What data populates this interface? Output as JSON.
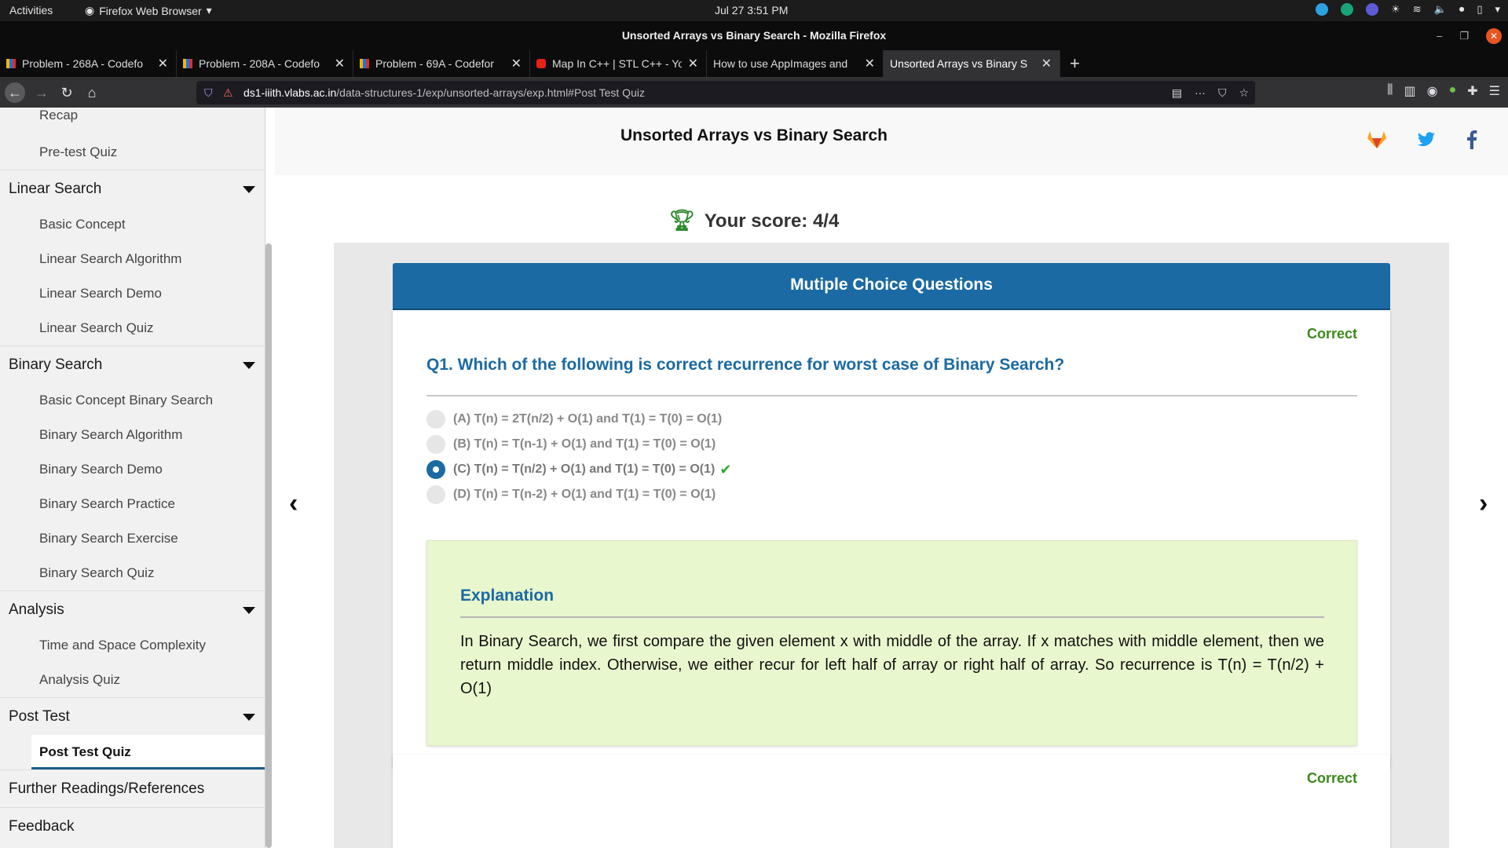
{
  "system": {
    "activities": "Activities",
    "app_name": "Firefox Web Browser",
    "clock": "Jul 27  3:51 PM"
  },
  "window": {
    "title": "Unsorted Arrays vs Binary Search - Mozilla Firefox"
  },
  "tabs": [
    {
      "label": "Problem - 268A - Codefo",
      "favicon": "codeforces"
    },
    {
      "label": "Problem - 208A - Codefo",
      "favicon": "codeforces"
    },
    {
      "label": "Problem - 69A - Codefor",
      "favicon": "codeforces"
    },
    {
      "label": "Map In C++ | STL C++ - Yo",
      "favicon": "youtube"
    },
    {
      "label": "How to use AppImages and",
      "favicon": "none"
    },
    {
      "label": "Unsorted Arrays vs Binary S",
      "favicon": "none",
      "active": true
    }
  ],
  "url": {
    "host": "ds1-iiith.vlabs.ac.in",
    "path": "/data-structures-1/exp/unsorted-arrays/exp.html#Post Test Quiz"
  },
  "sidebar": {
    "top_items": [
      "Recap",
      "Pre-test Quiz"
    ],
    "sections": [
      {
        "title": "Linear Search",
        "items": [
          "Basic Concept",
          "Linear Search Algorithm",
          "Linear Search Demo",
          "Linear Search Quiz"
        ]
      },
      {
        "title": "Binary Search",
        "items": [
          "Basic Concept Binary Search",
          "Binary Search Algorithm",
          "Binary Search Demo",
          "Binary Search Practice",
          "Binary Search Exercise",
          "Binary Search Quiz"
        ]
      },
      {
        "title": "Analysis",
        "items": [
          "Time and Space Complexity",
          "Analysis Quiz"
        ]
      },
      {
        "title": "Post Test",
        "items": [
          "Post Test Quiz"
        ]
      }
    ],
    "links": [
      "Further Readings/References",
      "Feedback"
    ]
  },
  "page": {
    "title": "Unsorted Arrays vs Binary Search",
    "score": "Your score: 4/4",
    "mcq_header": "Mutiple Choice Questions",
    "questions": [
      {
        "status": "Correct",
        "text": "Q1. Which of the following is correct recurrence for worst case of Binary Search?",
        "options": [
          "(A) T(n) = 2T(n/2) + O(1) and T(1) = T(0) = O(1)",
          "(B) T(n) = T(n-1) + O(1) and T(1) = T(0) = O(1)",
          "(C) T(n) = T(n/2) + O(1) and T(1) = T(0) = O(1)",
          "(D) T(n) = T(n-2) + O(1) and T(1) = T(0) = O(1)"
        ],
        "selected_index": 2,
        "explanation_title": "Explanation",
        "explanation": "In Binary Search, we first compare the given element x with middle of the array. If x matches with middle element, then we return middle index. Otherwise, we either recur for left half of array or right half of array. So recurrence is T(n) = T(n/2) + O(1)"
      },
      {
        "status": "Correct"
      }
    ]
  },
  "colors": {
    "accent": "#1b6aa3",
    "correct": "#3a8a1a",
    "explanation_bg": "#e9f7ce"
  }
}
